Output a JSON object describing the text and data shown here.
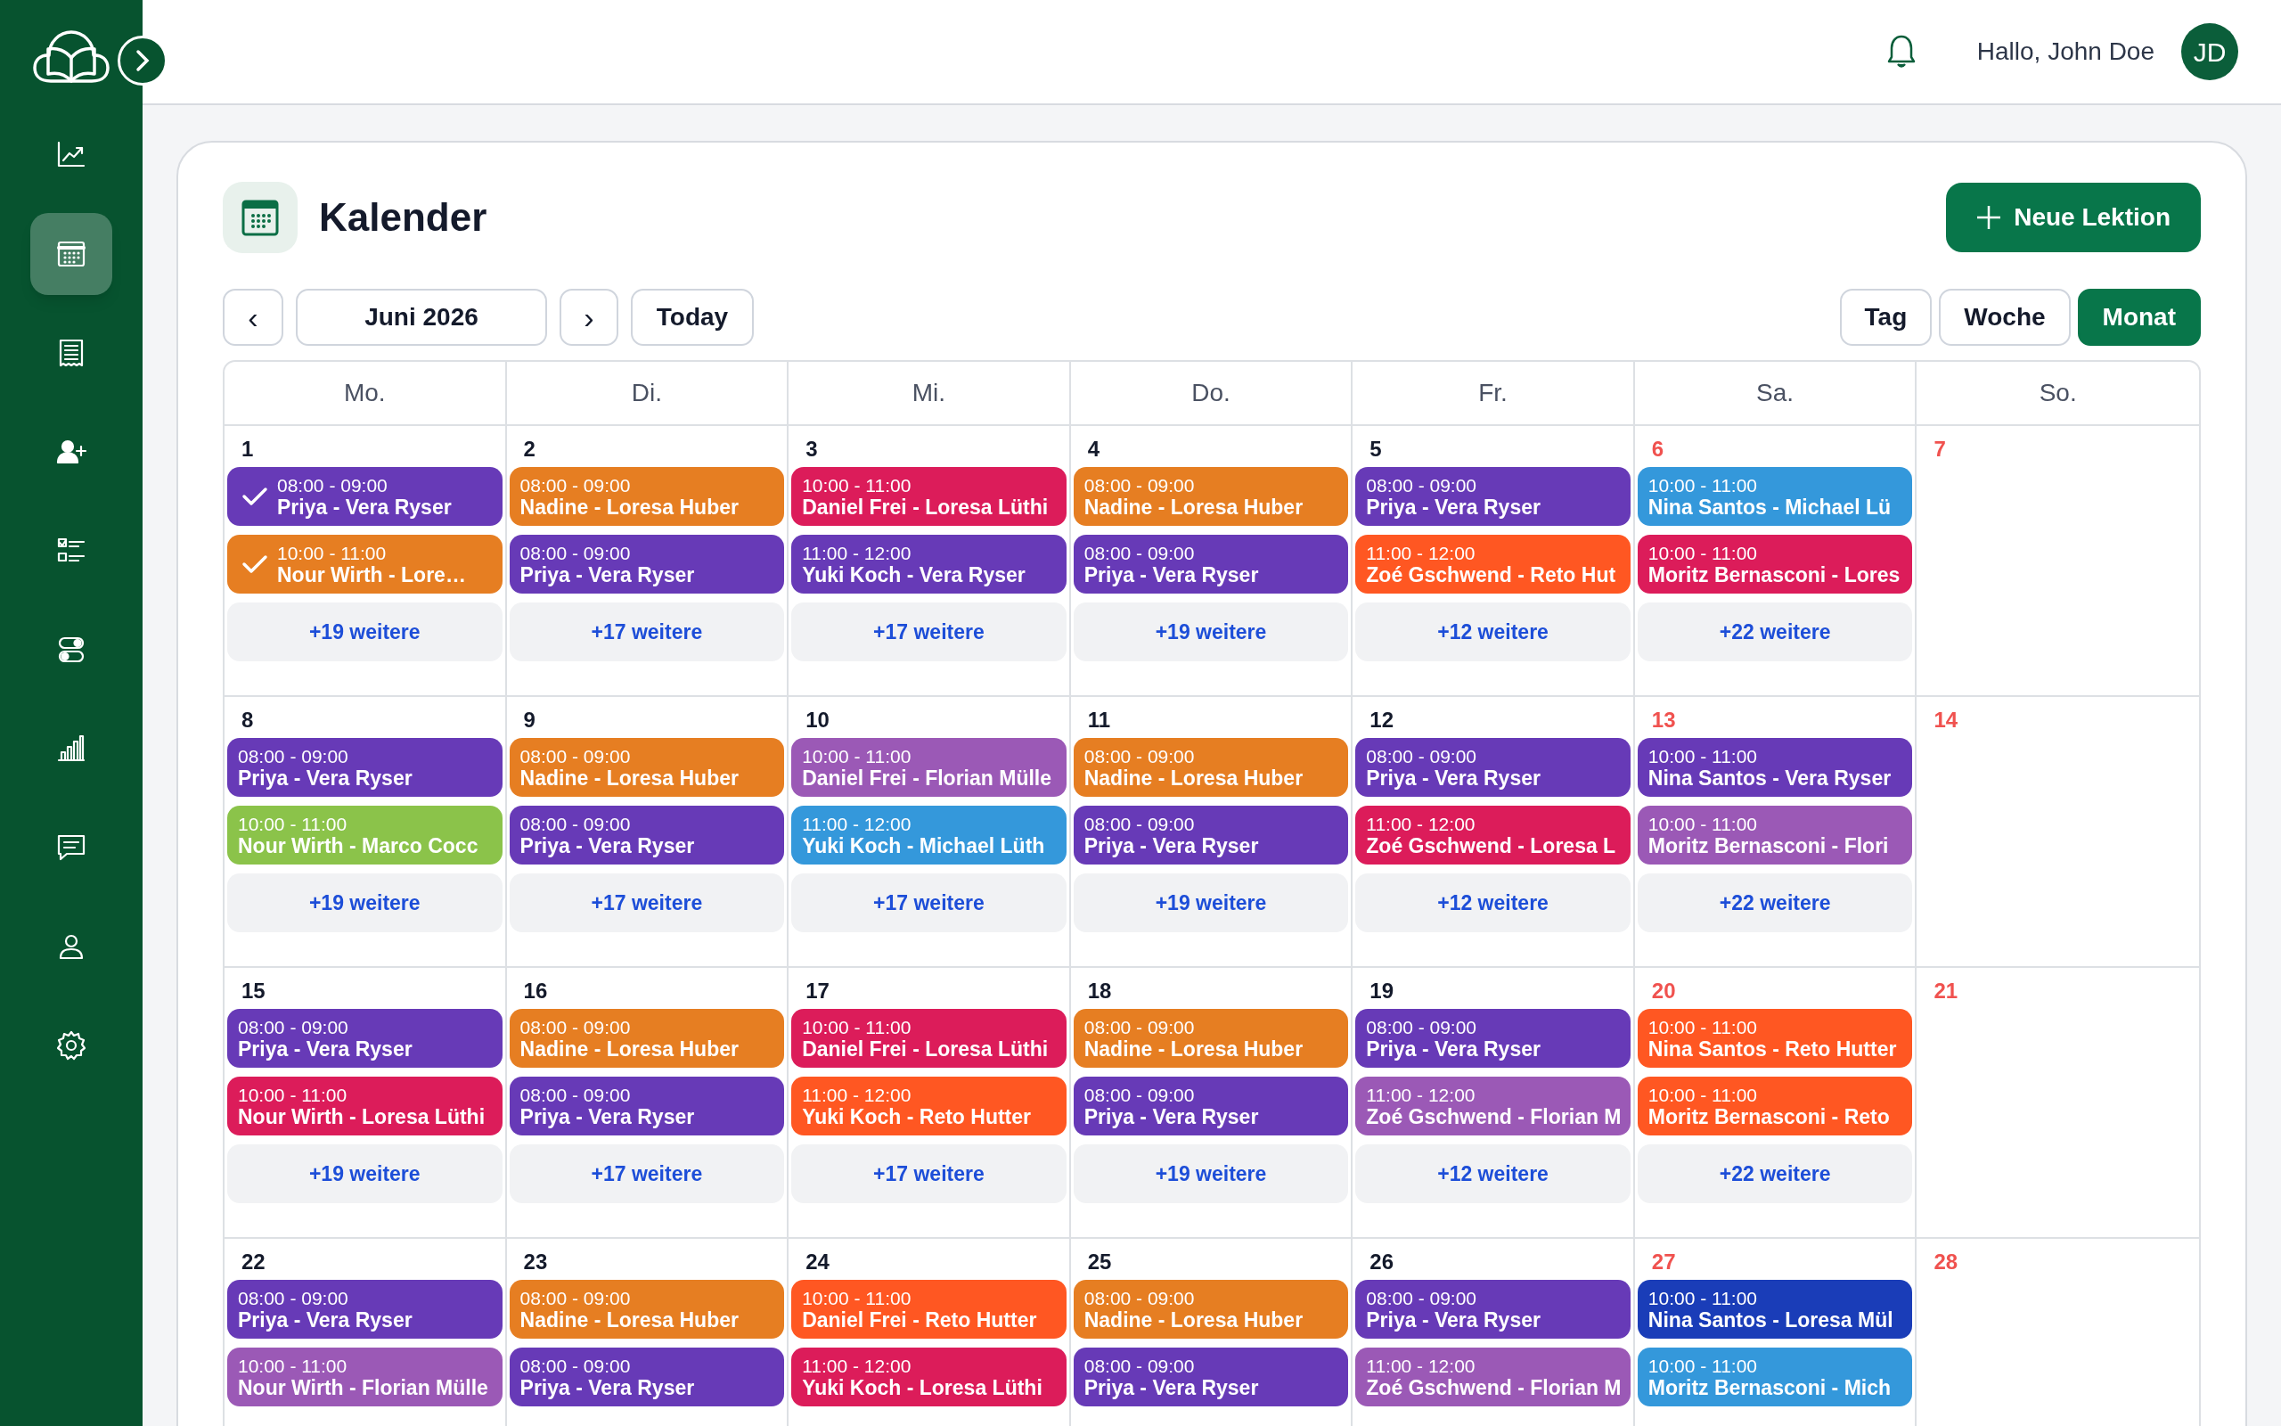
{
  "sidebar": {
    "items": [
      {
        "kind": "chart",
        "selected": false
      },
      {
        "kind": "calendar",
        "selected": true
      },
      {
        "kind": "receipt",
        "selected": false
      },
      {
        "kind": "add-user",
        "selected": false
      },
      {
        "kind": "checklist",
        "selected": false
      },
      {
        "kind": "toggles",
        "selected": false
      },
      {
        "kind": "bars",
        "selected": false
      },
      {
        "kind": "chat",
        "selected": false
      },
      {
        "kind": "user",
        "selected": false
      },
      {
        "kind": "settings",
        "selected": false
      }
    ]
  },
  "header": {
    "greeting": "Hallo, John Doe",
    "avatar": "JD"
  },
  "page": {
    "title": "Kalender",
    "new_button": "Neue Lektion"
  },
  "toolbar": {
    "prev": "‹",
    "month": "Juni 2026",
    "next": "›",
    "today": "Today",
    "views": [
      {
        "label": "Tag",
        "selected": false
      },
      {
        "label": "Woche",
        "selected": false
      },
      {
        "label": "Monat",
        "selected": true
      }
    ]
  },
  "weekdays": [
    "Mo.",
    "Di.",
    "Mi.",
    "Do.",
    "Fr.",
    "Sa.",
    "So."
  ],
  "weeks": [
    {
      "days": [
        {
          "number": "1",
          "weekend": false,
          "events": [
            {
              "time": "08:00 - 09:00",
              "title": "Priya - Vera Ryser",
              "color": "#673ab7",
              "done": true
            },
            {
              "time": "10:00 - 11:00",
              "title": "Nour Wirth - Lore…",
              "color": "#e67e22",
              "done": true
            }
          ],
          "more": "+19 weitere"
        },
        {
          "number": "2",
          "weekend": false,
          "events": [
            {
              "time": "08:00 - 09:00",
              "title": "Nadine - Loresa Huber",
              "color": "#e67e22",
              "done": false
            },
            {
              "time": "08:00 - 09:00",
              "title": "Priya - Vera Ryser",
              "color": "#673ab7",
              "done": false
            }
          ],
          "more": "+17 weitere"
        },
        {
          "number": "3",
          "weekend": false,
          "events": [
            {
              "time": "10:00 - 11:00",
              "title": "Daniel Frei - Loresa Lüthi",
              "color": "#dc1c5a",
              "done": false
            },
            {
              "time": "11:00 - 12:00",
              "title": "Yuki Koch - Vera Ryser",
              "color": "#673ab7",
              "done": false
            }
          ],
          "more": "+17 weitere"
        },
        {
          "number": "4",
          "weekend": false,
          "events": [
            {
              "time": "08:00 - 09:00",
              "title": "Nadine - Loresa Huber",
              "color": "#e67e22",
              "done": false
            },
            {
              "time": "08:00 - 09:00",
              "title": "Priya - Vera Ryser",
              "color": "#673ab7",
              "done": false
            }
          ],
          "more": "+19 weitere"
        },
        {
          "number": "5",
          "weekend": false,
          "events": [
            {
              "time": "08:00 - 09:00",
              "title": "Priya - Vera Ryser",
              "color": "#673ab7",
              "done": false
            },
            {
              "time": "11:00 - 12:00",
              "title": "Zoé Gschwend - Reto Hut",
              "color": "#ff5722",
              "done": false
            }
          ],
          "more": "+12 weitere"
        },
        {
          "number": "6",
          "weekend": true,
          "events": [
            {
              "time": "10:00 - 11:00",
              "title": "Nina Santos - Michael Lü",
              "color": "#3498db",
              "done": false
            },
            {
              "time": "10:00 - 11:00",
              "title": "Moritz Bernasconi - Lores",
              "color": "#dc1c5a",
              "done": false
            }
          ],
          "more": "+22 weitere"
        },
        {
          "number": "7",
          "weekend": true
        }
      ]
    },
    {
      "days": [
        {
          "number": "8",
          "weekend": false,
          "events": [
            {
              "time": "08:00 - 09:00",
              "title": "Priya - Vera Ryser",
              "color": "#673ab7",
              "done": false
            },
            {
              "time": "10:00 - 11:00",
              "title": "Nour Wirth - Marco Cocc",
              "color": "#8bc34a",
              "done": false
            }
          ],
          "more": "+19 weitere"
        },
        {
          "number": "9",
          "weekend": false,
          "events": [
            {
              "time": "08:00 - 09:00",
              "title": "Nadine - Loresa Huber",
              "color": "#e67e22",
              "done": false
            },
            {
              "time": "08:00 - 09:00",
              "title": "Priya - Vera Ryser",
              "color": "#673ab7",
              "done": false
            }
          ],
          "more": "+17 weitere"
        },
        {
          "number": "10",
          "weekend": false,
          "events": [
            {
              "time": "10:00 - 11:00",
              "title": "Daniel Frei - Florian Mülle",
              "color": "#9b59b6",
              "done": false
            },
            {
              "time": "11:00 - 12:00",
              "title": "Yuki Koch - Michael Lüth",
              "color": "#3498db",
              "done": false
            }
          ],
          "more": "+17 weitere"
        },
        {
          "number": "11",
          "weekend": false,
          "events": [
            {
              "time": "08:00 - 09:00",
              "title": "Nadine - Loresa Huber",
              "color": "#e67e22",
              "done": false
            },
            {
              "time": "08:00 - 09:00",
              "title": "Priya - Vera Ryser",
              "color": "#673ab7",
              "done": false
            }
          ],
          "more": "+19 weitere"
        },
        {
          "number": "12",
          "weekend": false,
          "events": [
            {
              "time": "08:00 - 09:00",
              "title": "Priya - Vera Ryser",
              "color": "#673ab7",
              "done": false
            },
            {
              "time": "11:00 - 12:00",
              "title": "Zoé Gschwend - Loresa L",
              "color": "#dc1c5a",
              "done": false
            }
          ],
          "more": "+12 weitere"
        },
        {
          "number": "13",
          "weekend": true,
          "events": [
            {
              "time": "10:00 - 11:00",
              "title": "Nina Santos - Vera Ryser",
              "color": "#673ab7",
              "done": false
            },
            {
              "time": "10:00 - 11:00",
              "title": "Moritz Bernasconi - Flori",
              "color": "#9b59b6",
              "done": false
            }
          ],
          "more": "+22 weitere"
        },
        {
          "number": "14",
          "weekend": true
        }
      ]
    },
    {
      "days": [
        {
          "number": "15",
          "weekend": false,
          "events": [
            {
              "time": "08:00 - 09:00",
              "title": "Priya - Vera Ryser",
              "color": "#673ab7",
              "done": false
            },
            {
              "time": "10:00 - 11:00",
              "title": "Nour Wirth - Loresa Lüthi",
              "color": "#dc1c5a",
              "done": false
            }
          ],
          "more": "+19 weitere"
        },
        {
          "number": "16",
          "weekend": false,
          "events": [
            {
              "time": "08:00 - 09:00",
              "title": "Nadine - Loresa Huber",
              "color": "#e67e22",
              "done": false
            },
            {
              "time": "08:00 - 09:00",
              "title": "Priya - Vera Ryser",
              "color": "#673ab7",
              "done": false
            }
          ],
          "more": "+17 weitere"
        },
        {
          "number": "17",
          "weekend": false,
          "events": [
            {
              "time": "10:00 - 11:00",
              "title": "Daniel Frei - Loresa Lüthi",
              "color": "#dc1c5a",
              "done": false
            },
            {
              "time": "11:00 - 12:00",
              "title": "Yuki Koch - Reto Hutter",
              "color": "#ff5722",
              "done": false
            }
          ],
          "more": "+17 weitere"
        },
        {
          "number": "18",
          "weekend": false,
          "events": [
            {
              "time": "08:00 - 09:00",
              "title": "Nadine - Loresa Huber",
              "color": "#e67e22",
              "done": false
            },
            {
              "time": "08:00 - 09:00",
              "title": "Priya - Vera Ryser",
              "color": "#673ab7",
              "done": false
            }
          ],
          "more": "+19 weitere"
        },
        {
          "number": "19",
          "weekend": false,
          "events": [
            {
              "time": "08:00 - 09:00",
              "title": "Priya - Vera Ryser",
              "color": "#673ab7",
              "done": false
            },
            {
              "time": "11:00 - 12:00",
              "title": "Zoé Gschwend - Florian M",
              "color": "#9b59b6",
              "done": false
            }
          ],
          "more": "+12 weitere"
        },
        {
          "number": "20",
          "weekend": true,
          "events": [
            {
              "time": "10:00 - 11:00",
              "title": "Nina Santos - Reto Hutter",
              "color": "#ff5722",
              "done": false
            },
            {
              "time": "10:00 - 11:00",
              "title": "Moritz Bernasconi - Reto",
              "color": "#ff5722",
              "done": false
            }
          ],
          "more": "+22 weitere"
        },
        {
          "number": "21",
          "weekend": true
        }
      ]
    },
    {
      "days": [
        {
          "number": "22",
          "weekend": false,
          "events": [
            {
              "time": "08:00 - 09:00",
              "title": "Priya - Vera Ryser",
              "color": "#673ab7",
              "done": false
            },
            {
              "time": "10:00 - 11:00",
              "title": "Nour Wirth - Florian Mülle",
              "color": "#9b59b6",
              "done": false
            }
          ]
        },
        {
          "number": "23",
          "weekend": false,
          "events": [
            {
              "time": "08:00 - 09:00",
              "title": "Nadine - Loresa Huber",
              "color": "#e67e22",
              "done": false
            },
            {
              "time": "08:00 - 09:00",
              "title": "Priya - Vera Ryser",
              "color": "#673ab7",
              "done": false
            }
          ]
        },
        {
          "number": "24",
          "weekend": false,
          "events": [
            {
              "time": "10:00 - 11:00",
              "title": "Daniel Frei - Reto Hutter",
              "color": "#ff5722",
              "done": false
            },
            {
              "time": "11:00 - 12:00",
              "title": "Yuki Koch - Loresa Lüthi",
              "color": "#dc1c5a",
              "done": false
            }
          ]
        },
        {
          "number": "25",
          "weekend": false,
          "events": [
            {
              "time": "08:00 - 09:00",
              "title": "Nadine - Loresa Huber",
              "color": "#e67e22",
              "done": false
            },
            {
              "time": "08:00 - 09:00",
              "title": "Priya - Vera Ryser",
              "color": "#673ab7",
              "done": false
            }
          ]
        },
        {
          "number": "26",
          "weekend": false,
          "events": [
            {
              "time": "08:00 - 09:00",
              "title": "Priya - Vera Ryser",
              "color": "#673ab7",
              "done": false
            },
            {
              "time": "11:00 - 12:00",
              "title": "Zoé Gschwend - Florian M",
              "color": "#9b59b6",
              "done": false
            }
          ]
        },
        {
          "number": "27",
          "weekend": true,
          "events": [
            {
              "time": "10:00 - 11:00",
              "title": "Nina Santos - Loresa Mül",
              "color": "#1a3db8",
              "done": false
            },
            {
              "time": "10:00 - 11:00",
              "title": "Moritz Bernasconi - Mich",
              "color": "#3498db",
              "done": false
            }
          ]
        },
        {
          "number": "28",
          "weekend": true
        }
      ]
    }
  ]
}
